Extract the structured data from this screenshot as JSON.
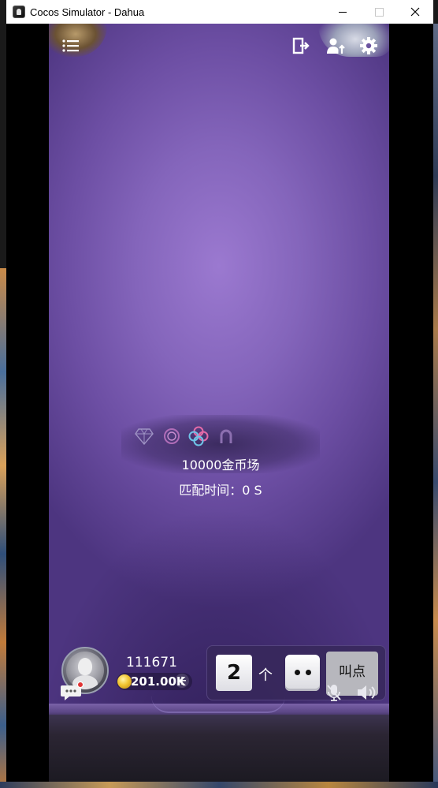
{
  "window": {
    "title": "Cocos Simulator - Dahua",
    "minimize": "minimize",
    "maximize": "maximize",
    "close": "close"
  },
  "toolbar": {
    "menu_icon": "list-icon",
    "exit_icon": "exit-door-icon",
    "player_icon": "user-upload-icon",
    "settings_icon": "gear-icon"
  },
  "room": {
    "gems": [
      "diamond-icon",
      "ring-icon",
      "clover-icon",
      "horseshoe-icon"
    ],
    "name": "10000金币场",
    "match_time": "匹配时间：0 S"
  },
  "player": {
    "id": "111671",
    "coins": "201.00K",
    "add_coins": "+"
  },
  "bid": {
    "count": "2",
    "unit": "个",
    "dice_face": 2,
    "call_label": "叫点"
  },
  "colors": {
    "table_top": "#9b79d0",
    "table_edge": "#4d3580",
    "panel": "#372a5a",
    "call_button": "#b7b7bd"
  }
}
